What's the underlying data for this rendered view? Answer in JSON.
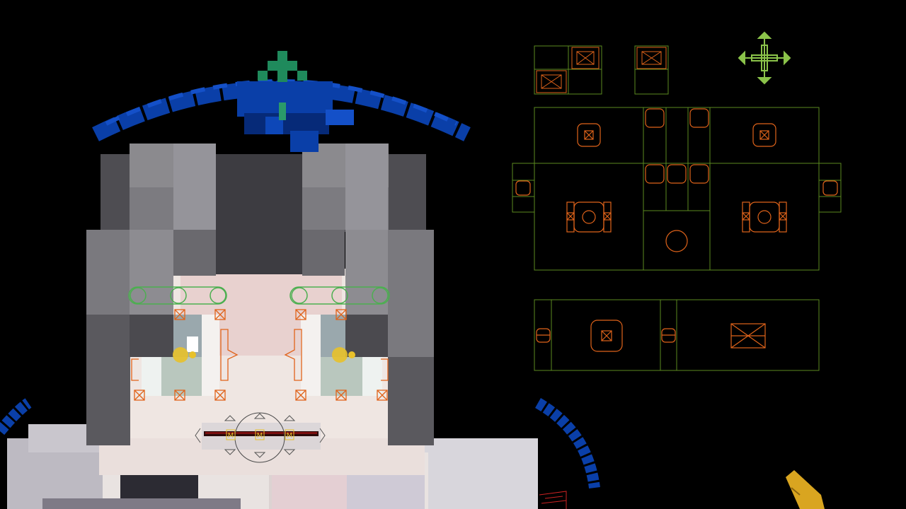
{
  "viewport": {
    "background": "#000000",
    "character": {
      "hair_light": "#8a8a8c",
      "hair_mid": "#6f6f73",
      "hair_dark": "#4a4a4e",
      "skin": "#efe6e2",
      "skin_pink": "#e7cfcd",
      "shirt": "#d8d6dc",
      "halo": "#0a3fa8",
      "halo_dark": "#062a78",
      "sprout": "#1f8a5c"
    },
    "controls": {
      "frame_color": "#5b8a1f",
      "handle_color": "#e0631a",
      "move_gizmo_color": "#8bc34a",
      "brow_color": "#4caf50",
      "mouth_ring_color": "#bdbdbd",
      "eye_marker_color": "#e8c12a"
    },
    "mouth_labels": [
      "M",
      "M",
      "M"
    ]
  }
}
